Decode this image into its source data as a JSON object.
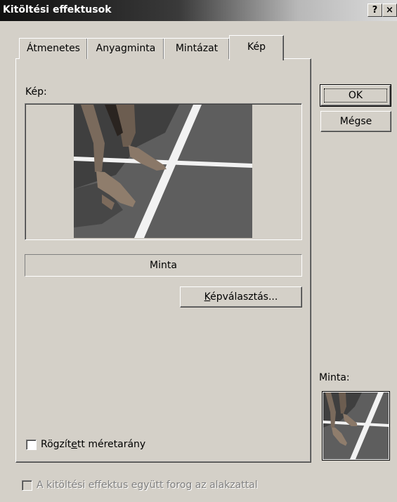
{
  "window": {
    "title": "Kitöltési effektusok",
    "help_button": "?",
    "close_button": "×"
  },
  "tabs": [
    {
      "label": "Átmenetes",
      "active": false
    },
    {
      "label": "Anyagminta",
      "active": false
    },
    {
      "label": "Mintázat",
      "active": false
    },
    {
      "label": "Kép",
      "active": true
    }
  ],
  "picture_tab": {
    "picture_label": "Kép:",
    "picture_name": "Minta",
    "select_picture_button_underlined": "K",
    "select_picture_button_rest": "épválasztás...",
    "lock_aspect_label_before": "Rögzít",
    "lock_aspect_label_underlined": "e",
    "lock_aspect_label_after": "tt méretarány",
    "lock_aspect_checked": false
  },
  "buttons": {
    "ok": "OK",
    "cancel": "Mégse"
  },
  "sample": {
    "label": "Minta:"
  },
  "footer": {
    "rotate_with_shape_label": "A kitöltési effektus együtt forog az alakzattal",
    "rotate_with_shape_checked": false,
    "rotate_with_shape_enabled": false
  },
  "colors": {
    "dialog_bg": "#d4d0c8",
    "track": "#5a5a5a",
    "lane_line": "#f2f2f2"
  },
  "icons": {
    "help": "question-mark-icon",
    "close": "close-icon"
  }
}
